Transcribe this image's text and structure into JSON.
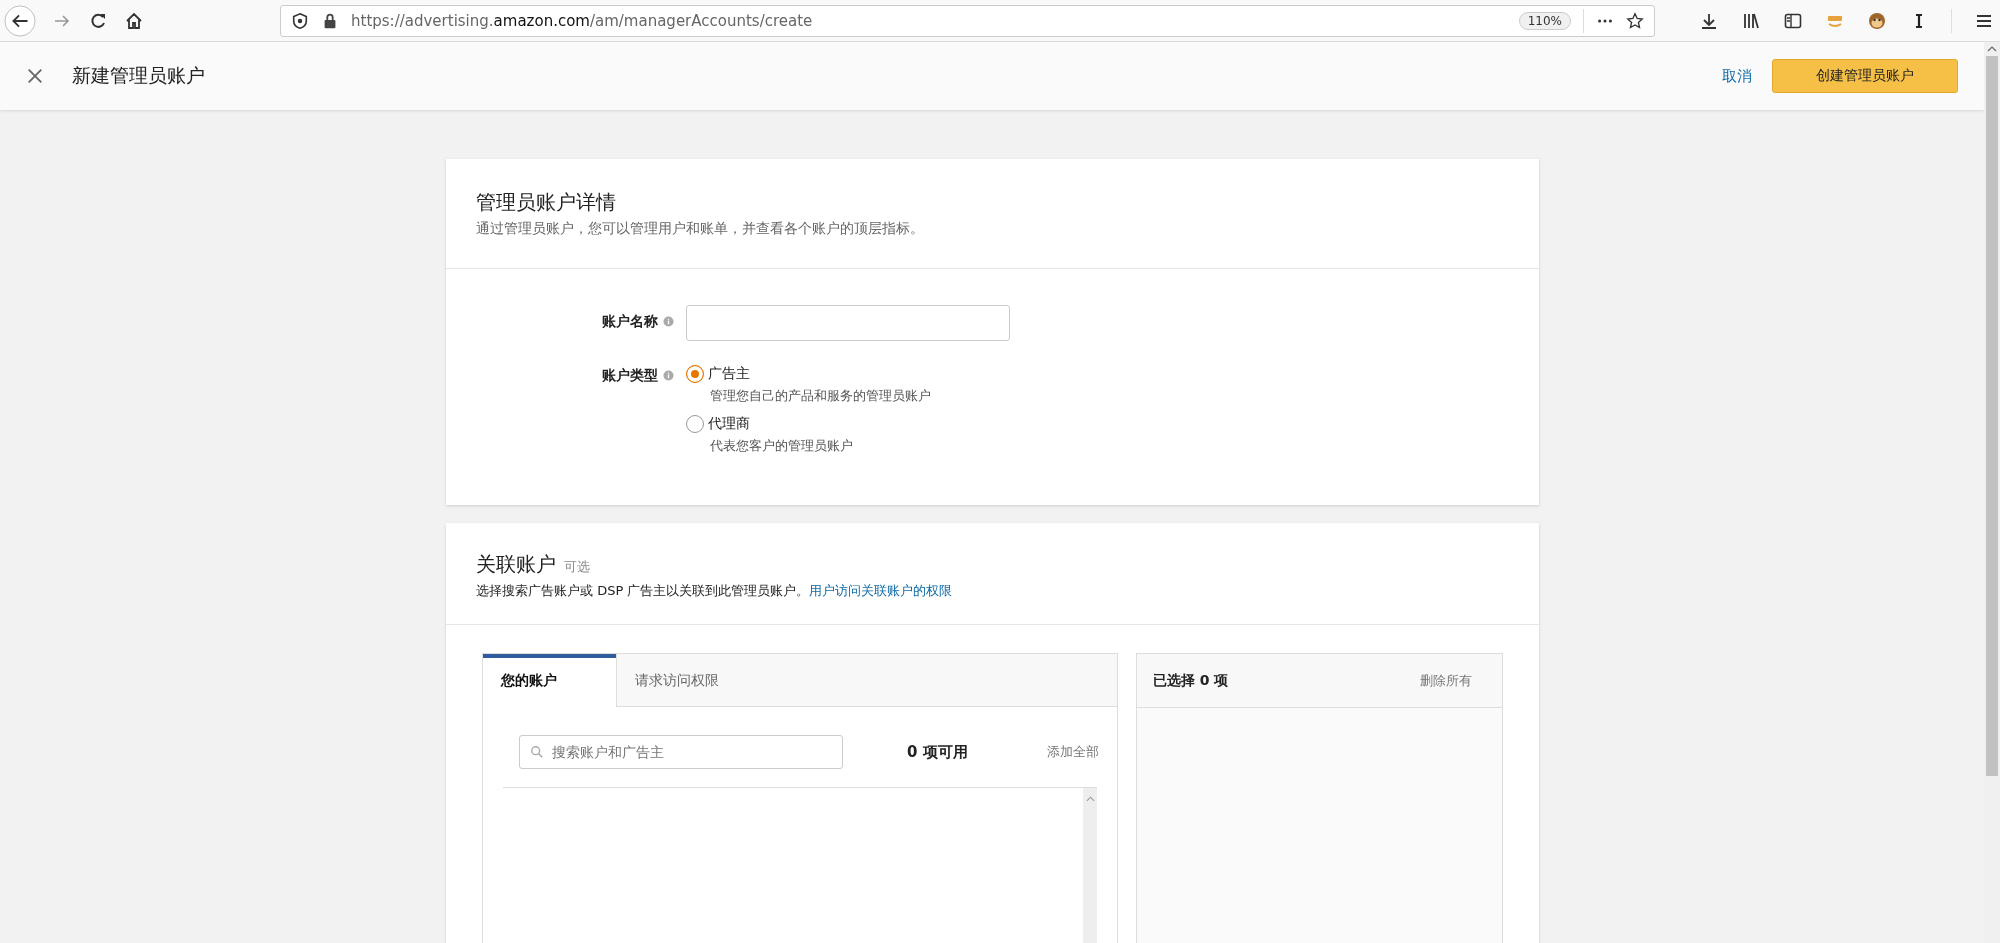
{
  "browser": {
    "url": "https://advertising.**amazon.com**/am/managerAccounts/create",
    "zoom": "110%"
  },
  "header": {
    "title": "新建管理员账户",
    "cancel": "取消",
    "create": "创建管理员账户"
  },
  "details": {
    "title": "管理员账户详情",
    "subtitle": "通过管理员账户，您可以管理用户和账单，并查看各个账户的顶层指标。",
    "fields": [
      {
        "kind": "text",
        "label": "账户名称"
      },
      {
        "kind": "radio",
        "label": "账户类型",
        "options": [
          {
            "label": "广告主",
            "description": "管理您自己的产品和服务的管理员账户",
            "selected": true
          },
          {
            "label": "代理商",
            "description": "代表您客户的管理员账户",
            "selected": false
          }
        ]
      }
    ]
  },
  "linked": {
    "title": "关联账户",
    "optional": "可选",
    "description": "选择搜索广告账户或 DSP 广告主以关联到此管理员账户。",
    "link": "用户访问关联账户的权限",
    "tabs": [
      {
        "label": "您的账户",
        "selected": true
      },
      {
        "label": "请求访问权限",
        "selected": false
      }
    ],
    "search": {
      "placeholder": "搜索账户和广告主"
    },
    "count": "0 项可用",
    "add_all": "添加全部",
    "selected_panel": {
      "title": "已选择 0 项",
      "remove_all": "删除所有"
    }
  }
}
